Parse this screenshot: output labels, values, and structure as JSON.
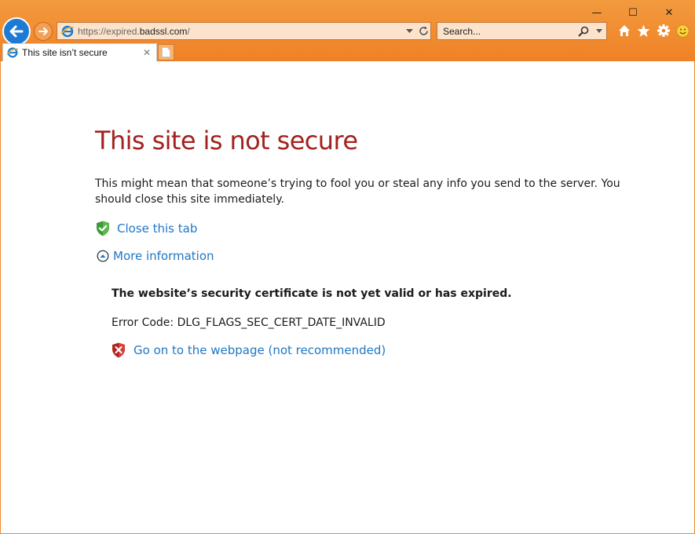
{
  "window": {
    "minimize_glyph": "—",
    "maximize_glyph": "☐",
    "close_glyph": "✕"
  },
  "address": {
    "prefix": "https://expired.",
    "host": "badssl.com",
    "suffix": "/"
  },
  "search": {
    "placeholder": "Search..."
  },
  "tab": {
    "title": "This site isn’t secure",
    "close_glyph": "✕"
  },
  "page": {
    "heading": "This site is not secure",
    "description": "This might mean that someone’s trying to fool you or steal any info you send to the server. You should close this site immediately.",
    "close_tab_link": "Close this tab",
    "more_info_link": "More information",
    "cert_message": "The website’s security certificate is not yet valid or has expired.",
    "error_code": "Error Code: DLG_FLAGS_SEC_CERT_DATE_INVALID",
    "go_on_link": "Go on to the webpage (not recommended)"
  },
  "colors": {
    "chrome_orange": "#ef8126",
    "heading_red": "#a3211f",
    "link_blue": "#1e77c4",
    "back_blue": "#1d7bd6"
  },
  "icons": {
    "back": "back-arrow-icon",
    "forward": "forward-arrow-icon",
    "site": "ie-icon",
    "dropdown": "chevron-down-icon",
    "refresh": "refresh-icon",
    "search": "search-icon",
    "home": "home-icon",
    "favorites": "star-icon",
    "settings": "gear-icon",
    "feedback": "smiley-icon",
    "new_tab": "new-tab-icon",
    "shield_ok": "shield-check-icon",
    "expand": "expand-circle-icon",
    "shield_bad": "shield-x-icon"
  }
}
